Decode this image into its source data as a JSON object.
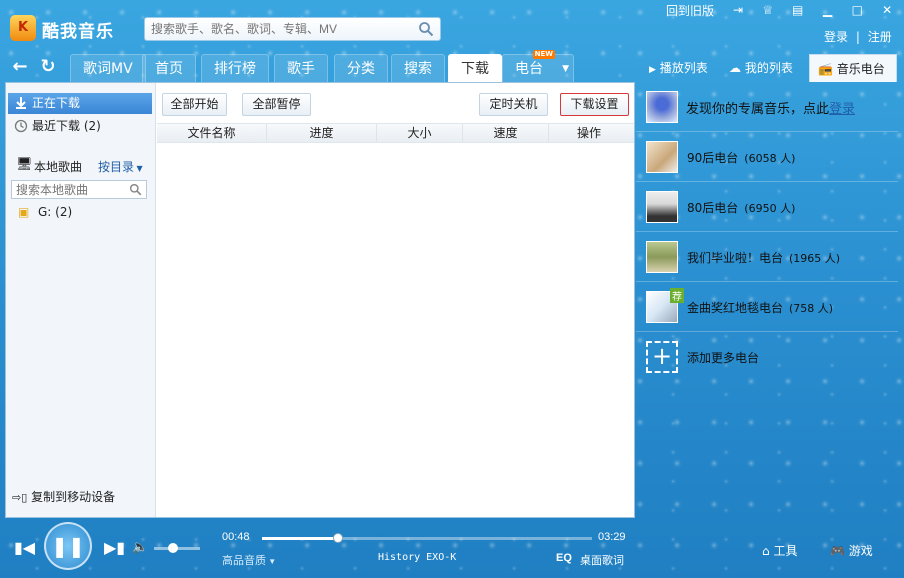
{
  "app": {
    "title": "酷我音乐",
    "logo_text": "K"
  },
  "search": {
    "placeholder": "搜索歌手、歌名、歌词、专辑、MV"
  },
  "window": {
    "old_version": "回到旧版"
  },
  "account": {
    "login": "登录",
    "separator": "|",
    "register": "注册"
  },
  "nav": {
    "tabs": [
      {
        "label": "歌词MV"
      },
      {
        "label": "首页"
      },
      {
        "label": "排行榜"
      },
      {
        "label": "歌手"
      },
      {
        "label": "分类"
      },
      {
        "label": "搜索"
      },
      {
        "label": "下载"
      },
      {
        "label": "电台",
        "badge": "NEW"
      }
    ]
  },
  "right_tabs": [
    {
      "label": "播放列表"
    },
    {
      "label": "我的列表"
    },
    {
      "label": "音乐电台"
    }
  ],
  "left_panel": {
    "downloading": "正在下载",
    "recent": "最近下载",
    "recent_count": "(2)",
    "local_songs": "本地歌曲",
    "by_dir": "按目录",
    "local_search_placeholder": "搜索本地歌曲",
    "folder": "G:",
    "folder_count": "(2)",
    "copy_device": "复制到移动设备"
  },
  "toolbar": {
    "start_all": "全部开始",
    "pause_all": "全部暂停",
    "timer_shutdown": "定时关机",
    "download_settings": "下载设置"
  },
  "table": {
    "columns": [
      "文件名称",
      "进度",
      "大小",
      "速度",
      "操作"
    ]
  },
  "radio": {
    "discover": "发现你的专属音乐，点此",
    "discover_link": "登录",
    "stations": [
      {
        "name": "90后电台",
        "count": "(6058 人)"
      },
      {
        "name": "80后电台",
        "count": "(6950 人)"
      },
      {
        "name": "我们毕业啦！电台",
        "count": "(1965 人)"
      },
      {
        "name": "金曲奖红地毯电台",
        "count": "(758 人)",
        "badge": "荐"
      }
    ],
    "add_more": "添加更多电台"
  },
  "player": {
    "elapsed": "00:48",
    "total": "03:29",
    "progress": 0.23,
    "quality": "高品音质",
    "now_playing": "History EXO-K",
    "eq": "EQ",
    "desktop_lyrics": "桌面歌词",
    "tools": "工具",
    "games": "游戏"
  },
  "colors": {
    "accent": "#2a8fd0",
    "highlight_border": "#d9373a",
    "selected": "#3b86d6"
  }
}
